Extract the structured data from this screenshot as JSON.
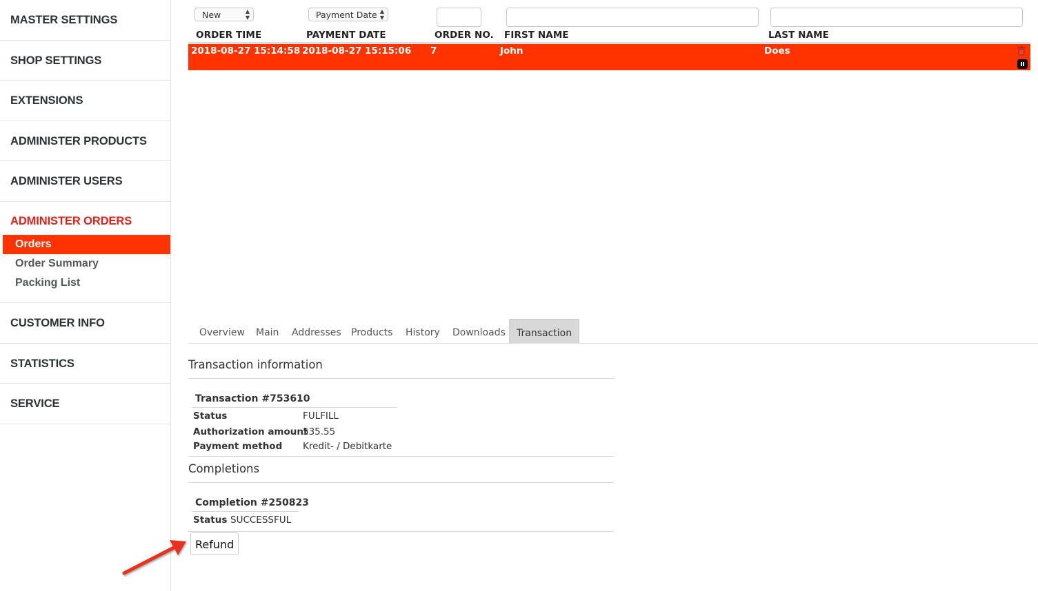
{
  "sidebar": {
    "sections": {
      "master_settings": "MASTER SETTINGS",
      "shop_settings": "SHOP SETTINGS",
      "extensions": "EXTENSIONS",
      "administer_products": "ADMINISTER PRODUCTS",
      "administer_users": "ADMINISTER USERS",
      "administer_orders": "ADMINISTER ORDERS",
      "customer_info": "CUSTOMER INFO",
      "statistics": "STATISTICS",
      "service": "SERVICE"
    },
    "order_subitems": [
      "Orders",
      "Order Summary",
      "Packing List"
    ],
    "active_color": "#e0211a",
    "selected_bg": "#ff3300"
  },
  "filters": {
    "status_select": "New",
    "date_select": "Payment Date",
    "order_no_value": "",
    "first_name_value": "",
    "last_name_value": ""
  },
  "columns": {
    "order_time": "ORDER TIME",
    "payment_date": "PAYMENT DATE",
    "order_no": "ORDER NO.",
    "first_name": "FIRST NAME",
    "last_name": "LAST NAME"
  },
  "order": {
    "order_time": "2018-08-27 15:14:58",
    "payment_date": "2018-08-27 15:15:06",
    "order_no": "7",
    "first_name": "John",
    "last_name": "Does",
    "row_color": "#ff3300"
  },
  "tabs": [
    "Overview",
    "Main",
    "Addresses",
    "Products",
    "History",
    "Downloads",
    "Transaction"
  ],
  "active_tab": "Transaction",
  "transaction": {
    "section_title": "Transaction information",
    "heading": "Transaction #753610",
    "status_label": "Status",
    "status_value": "FULFILL",
    "amount_label": "Authorization amount",
    "amount_value": "535.55",
    "method_label": "Payment method",
    "method_value": "Kredit- / Debitkarte"
  },
  "completions": {
    "section_title": "Completions",
    "heading": "Completion #250823",
    "status_label": "Status",
    "status_value": "SUCCESSFUL"
  },
  "refund_label": "Refund",
  "icons": {
    "trash": "trash-icon",
    "pause": "pause-icon",
    "annotation_arrow": "arrow-annotation-icon"
  }
}
